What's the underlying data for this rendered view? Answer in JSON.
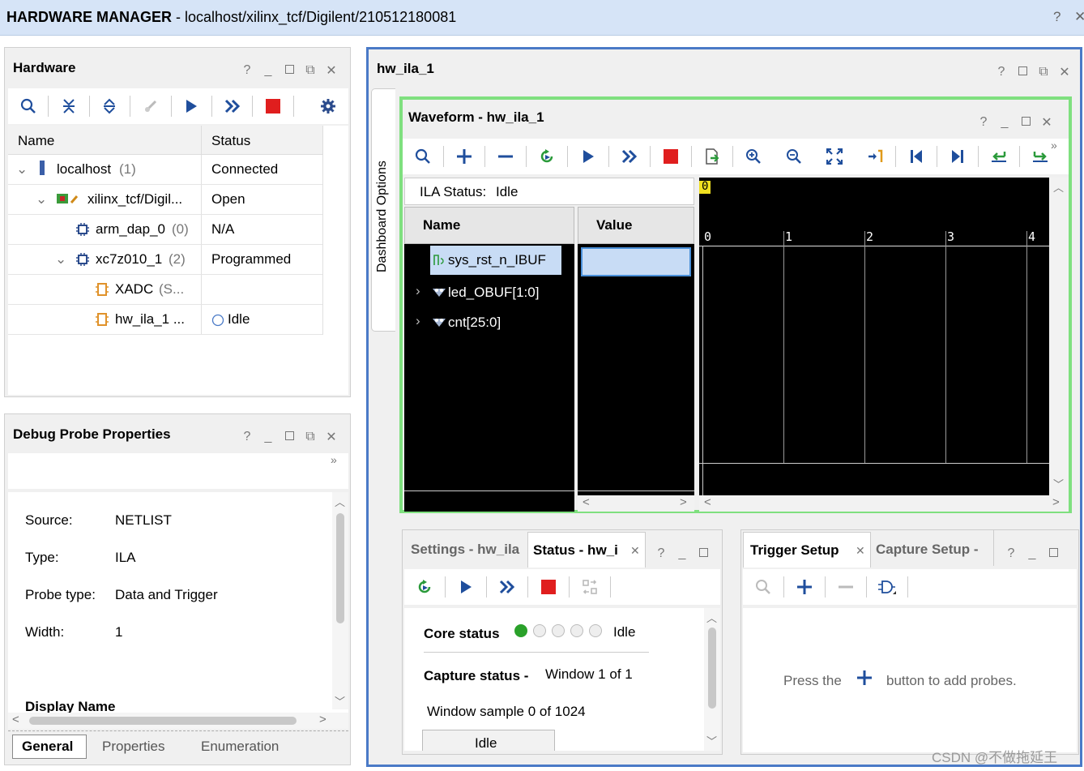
{
  "title_bar": {
    "app": "HARDWARE MANAGER",
    "path": " - localhost/xilinx_tcf/Digilent/210512180081",
    "help": "?"
  },
  "hardware_panel": {
    "title": "Hardware",
    "columns": [
      "Name",
      "Status"
    ],
    "rows": [
      {
        "name": "localhost",
        "count": "(1)",
        "status": "Connected"
      },
      {
        "name": "xilinx_tcf/Digil...",
        "count": "",
        "status": "Open"
      },
      {
        "name": "arm_dap_0",
        "count": "(0)",
        "status": "N/A"
      },
      {
        "name": "xc7z010_1",
        "count": "(2)",
        "status": "Programmed"
      },
      {
        "name": "XADC",
        "count": "(S...",
        "status": ""
      },
      {
        "name": "hw_ila_1 ...",
        "count": "",
        "status": "Idle"
      }
    ]
  },
  "debug_probe_panel": {
    "title": "Debug Probe Properties",
    "props": [
      {
        "label": "Source:",
        "value": "NETLIST"
      },
      {
        "label": "Type:",
        "value": "ILA"
      },
      {
        "label": "Probe type:",
        "value": "Data and Trigger"
      },
      {
        "label": "Width:",
        "value": "1"
      }
    ],
    "section": "Display Name",
    "tabs": [
      "General",
      "Properties",
      "Enumeration"
    ]
  },
  "ila_panel": {
    "title": "hw_ila_1",
    "side_tab": "Dashboard Options"
  },
  "waveform": {
    "title": "Waveform - hw_ila_1",
    "ila_status_label": "ILA Status:",
    "ila_status_value": "Idle",
    "name_header": "Name",
    "value_header": "Value",
    "signals": [
      "sys_rst_n_IBUF",
      "led_OBUF[1:0]",
      "cnt[25:0]"
    ],
    "cursor_label": "0",
    "time_ticks": [
      "0",
      "1",
      "2",
      "3",
      "4"
    ]
  },
  "status_panel": {
    "tabs": [
      "Settings - hw_ila",
      "Status - hw_i"
    ],
    "core_status_label": "Core status",
    "core_status_value": "Idle",
    "capture_status_label": "Capture status -",
    "capture_window": "Window 1 of 1",
    "window_sample": "Window sample 0 of 1024",
    "button": "Idle"
  },
  "trigger_panel": {
    "tabs": [
      "Trigger Setup",
      "Capture Setup -"
    ],
    "hint_before": "Press the",
    "hint_after": "button to add probes."
  },
  "watermark": "CSDN @不做拖延王",
  "colors": {
    "title_bg": "#d6e4f7",
    "ila_border": "#4a7ac7",
    "waveform_border": "#7fe07f",
    "stop_red": "#e01e1e",
    "run_blue": "#1f4e9c"
  }
}
